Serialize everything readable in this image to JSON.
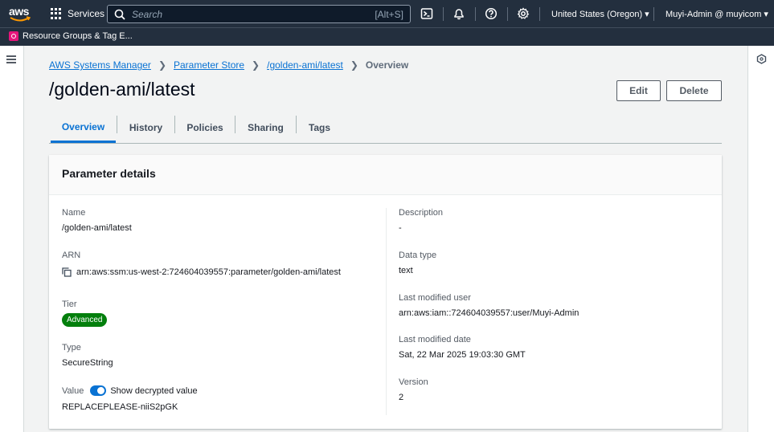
{
  "topnav": {
    "logo_text": "aws",
    "services_label": "Services",
    "search_placeholder": "Search",
    "search_shortcut": "[Alt+S]",
    "region": "United States (Oregon) ▾",
    "user": "Muyi-Admin @ muyicom ▾",
    "icons": [
      "cloudshell-icon",
      "bell-icon",
      "help-icon",
      "gear-icon"
    ]
  },
  "favorites": {
    "item": "Resource Groups & Tag E..."
  },
  "breadcrumb": {
    "items": [
      "AWS Systems Manager",
      "Parameter Store",
      "/golden-ami/latest"
    ],
    "current": "Overview"
  },
  "page": {
    "title": "/golden-ami/latest",
    "edit_label": "Edit",
    "delete_label": "Delete"
  },
  "tabs": [
    "Overview",
    "History",
    "Policies",
    "Sharing",
    "Tags"
  ],
  "active_tab": "Overview",
  "details": {
    "title": "Parameter details",
    "left": {
      "name_label": "Name",
      "name_value": "/golden-ami/latest",
      "arn_label": "ARN",
      "arn_value": "arn:aws:ssm:us-west-2:724604039557:parameter/golden-ami/latest",
      "tier_label": "Tier",
      "tier_value": "Advanced",
      "type_label": "Type",
      "type_value": "SecureString",
      "value_label": "Value",
      "toggle_label": "Show decrypted value",
      "value_value": "REPLACEPLEASE-niiS2pGK"
    },
    "right": {
      "description_label": "Description",
      "description_value": "-",
      "datatype_label": "Data type",
      "datatype_value": "text",
      "modified_user_label": "Last modified user",
      "modified_user_value": "arn:aws:iam::724604039557:user/Muyi-Admin",
      "modified_date_label": "Last modified date",
      "modified_date_value": "Sat, 22 Mar 2025 19:03:30 GMT",
      "version_label": "Version",
      "version_value": "2"
    }
  },
  "colors": {
    "nav_bg": "#232f3e",
    "link": "#0972d3",
    "badge_green": "#037f0c",
    "favorite_icon": "#e7157b"
  }
}
